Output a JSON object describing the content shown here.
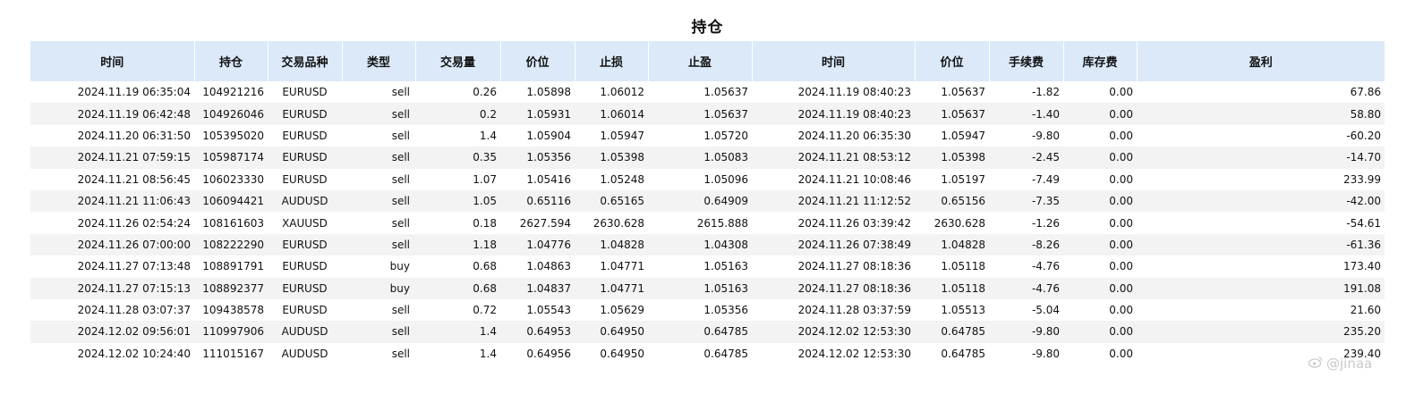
{
  "title": "持仓",
  "columns": [
    "时间",
    "持仓",
    "交易品种",
    "类型",
    "交易量",
    "价位",
    "止损",
    "止盈",
    "时间",
    "价位",
    "手续费",
    "库存费",
    "盈利"
  ],
  "rows": [
    [
      "2024.11.19 06:35:04",
      "104921216",
      "EURUSD",
      "sell",
      "0.26",
      "1.05898",
      "1.06012",
      "1.05637",
      "2024.11.19 08:40:23",
      "1.05637",
      "-1.82",
      "0.00",
      "67.86"
    ],
    [
      "2024.11.19 06:42:48",
      "104926046",
      "EURUSD",
      "sell",
      "0.2",
      "1.05931",
      "1.06014",
      "1.05637",
      "2024.11.19 08:40:23",
      "1.05637",
      "-1.40",
      "0.00",
      "58.80"
    ],
    [
      "2024.11.20 06:31:50",
      "105395020",
      "EURUSD",
      "sell",
      "1.4",
      "1.05904",
      "1.05947",
      "1.05720",
      "2024.11.20 06:35:30",
      "1.05947",
      "-9.80",
      "0.00",
      "-60.20"
    ],
    [
      "2024.11.21 07:59:15",
      "105987174",
      "EURUSD",
      "sell",
      "0.35",
      "1.05356",
      "1.05398",
      "1.05083",
      "2024.11.21 08:53:12",
      "1.05398",
      "-2.45",
      "0.00",
      "-14.70"
    ],
    [
      "2024.11.21 08:56:45",
      "106023330",
      "EURUSD",
      "sell",
      "1.07",
      "1.05416",
      "1.05248",
      "1.05096",
      "2024.11.21 10:08:46",
      "1.05197",
      "-7.49",
      "0.00",
      "233.99"
    ],
    [
      "2024.11.21 11:06:43",
      "106094421",
      "AUDUSD",
      "sell",
      "1.05",
      "0.65116",
      "0.65165",
      "0.64909",
      "2024.11.21 11:12:52",
      "0.65156",
      "-7.35",
      "0.00",
      "-42.00"
    ],
    [
      "2024.11.26 02:54:24",
      "108161603",
      "XAUUSD",
      "sell",
      "0.18",
      "2627.594",
      "2630.628",
      "2615.888",
      "2024.11.26 03:39:42",
      "2630.628",
      "-1.26",
      "0.00",
      "-54.61"
    ],
    [
      "2024.11.26 07:00:00",
      "108222290",
      "EURUSD",
      "sell",
      "1.18",
      "1.04776",
      "1.04828",
      "1.04308",
      "2024.11.26 07:38:49",
      "1.04828",
      "-8.26",
      "0.00",
      "-61.36"
    ],
    [
      "2024.11.27 07:13:48",
      "108891791",
      "EURUSD",
      "buy",
      "0.68",
      "1.04863",
      "1.04771",
      "1.05163",
      "2024.11.27 08:18:36",
      "1.05118",
      "-4.76",
      "0.00",
      "173.40"
    ],
    [
      "2024.11.27 07:15:13",
      "108892377",
      "EURUSD",
      "buy",
      "0.68",
      "1.04837",
      "1.04771",
      "1.05163",
      "2024.11.27 08:18:36",
      "1.05118",
      "-4.76",
      "0.00",
      "191.08"
    ],
    [
      "2024.11.28 03:07:37",
      "109438578",
      "EURUSD",
      "sell",
      "0.72",
      "1.05543",
      "1.05629",
      "1.05356",
      "2024.11.28 03:37:59",
      "1.05513",
      "-5.04",
      "0.00",
      "21.60"
    ],
    [
      "2024.12.02 09:56:01",
      "110997906",
      "AUDUSD",
      "sell",
      "1.4",
      "0.64953",
      "0.64950",
      "0.64785",
      "2024.12.02 12:53:30",
      "0.64785",
      "-9.80",
      "0.00",
      "235.20"
    ],
    [
      "2024.12.02 10:24:40",
      "111015167",
      "AUDUSD",
      "sell",
      "1.4",
      "0.64956",
      "0.64950",
      "0.64785",
      "2024.12.02 12:53:30",
      "0.64785",
      "-9.80",
      "0.00",
      "239.40"
    ]
  ],
  "watermark": {
    "icon": "weibo-icon",
    "text": "@jinaa"
  },
  "colors": {
    "header_bg": "#dbe9f9",
    "alt_row_bg": "#f3f3f3"
  }
}
